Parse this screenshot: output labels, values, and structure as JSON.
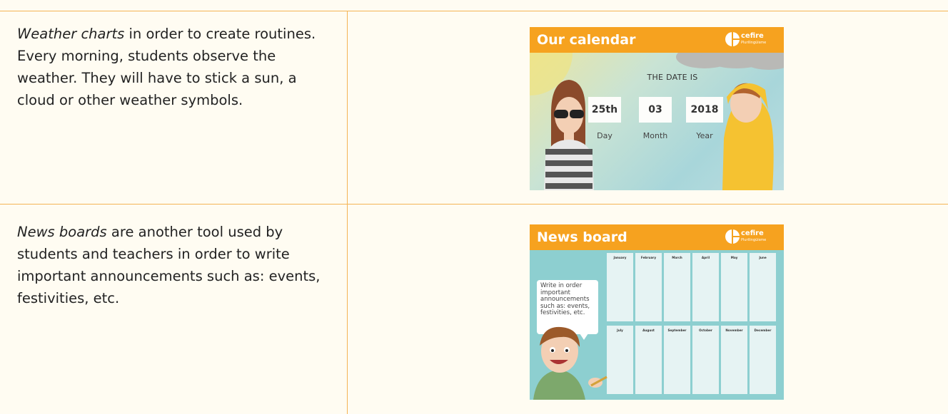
{
  "rows": [
    {
      "emphasis": "Weather charts",
      "text": " in order to create routines. Every morning, students observe the weather. They will have to stick a sun, a cloud or other weather symbols."
    },
    {
      "emphasis": "News boards",
      "text": " are another tool used by students and teachers in order to write important announcements such as: events, festivities, etc."
    }
  ],
  "calendar": {
    "title": "Our calendar",
    "logo": "cefire",
    "logo_sub": "Plurilingüisme",
    "date_title": "THE DATE IS",
    "day_value": "25th",
    "month_value": "03",
    "year_value": "2018",
    "day_label": "Day",
    "month_label": "Month",
    "year_label": "Year"
  },
  "news": {
    "title": "News board",
    "logo": "cefire",
    "logo_sub": "Plurilingüisme",
    "bubble": "Write in order important announcements such as: events, festivities, etc.",
    "months": [
      "January",
      "February",
      "March",
      "April",
      "May",
      "June",
      "July",
      "August",
      "September",
      "October",
      "November",
      "December"
    ]
  },
  "colors": {
    "background": "#fffcf2",
    "border": "#f4b454",
    "banner": "#f6a21f",
    "news_bg": "#8dcfd0"
  }
}
